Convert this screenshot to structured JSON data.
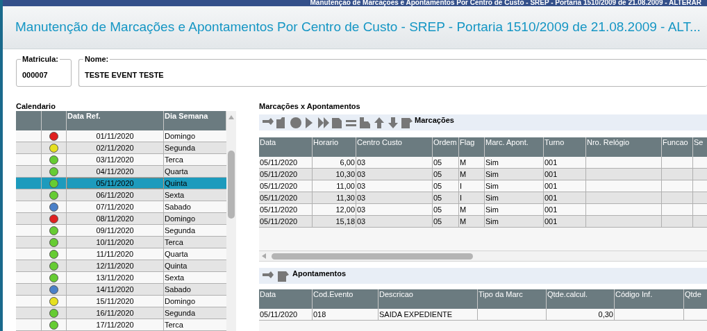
{
  "window": {
    "title": "Manutenção de Marcações e Apontamentos Por Centro de Custo - SREP - Portaria 1510/2009 de 21.08.2009 - ALTERAR"
  },
  "header": {
    "title": "Manutenção de Marcações e Apontamentos Por Centro de Custo - SREP - Portaria 1510/2009 de 21.08.2009 - ALT..."
  },
  "fields": [
    {
      "label": "Matricula:",
      "value": "000007"
    },
    {
      "label": "Nome:",
      "value": "TESTE EVENT TESTE"
    }
  ],
  "calendar": {
    "title": "Calendario",
    "columns": [
      "Data Ref.",
      "Dia Semana"
    ],
    "rows": [
      {
        "date": "01/11/2020",
        "day": "Domingo",
        "color": "#e02020",
        "selected": false
      },
      {
        "date": "02/11/2020",
        "day": "Segunda",
        "color": "#e6e020",
        "selected": false
      },
      {
        "date": "03/11/2020",
        "day": "Terca",
        "color": "#66cc33",
        "selected": false
      },
      {
        "date": "04/11/2020",
        "day": "Quarta",
        "color": "#66cc33",
        "selected": false
      },
      {
        "date": "05/11/2020",
        "day": "Quinta",
        "color": "#66cc33",
        "selected": true
      },
      {
        "date": "06/11/2020",
        "day": "Sexta",
        "color": "#66cc33",
        "selected": false
      },
      {
        "date": "07/11/2020",
        "day": "Sabado",
        "color": "#4a80c8",
        "selected": false
      },
      {
        "date": "08/11/2020",
        "day": "Domingo",
        "color": "#e02020",
        "selected": false
      },
      {
        "date": "09/11/2020",
        "day": "Segunda",
        "color": "#66cc33",
        "selected": false
      },
      {
        "date": "10/11/2020",
        "day": "Terca",
        "color": "#66cc33",
        "selected": false
      },
      {
        "date": "11/11/2020",
        "day": "Quarta",
        "color": "#66cc33",
        "selected": false
      },
      {
        "date": "12/11/2020",
        "day": "Quinta",
        "color": "#66cc33",
        "selected": false
      },
      {
        "date": "13/11/2020",
        "day": "Sexta",
        "color": "#66cc33",
        "selected": false
      },
      {
        "date": "14/11/2020",
        "day": "Sabado",
        "color": "#4a80c8",
        "selected": false
      },
      {
        "date": "15/11/2020",
        "day": "Domingo",
        "color": "#e6e020",
        "selected": false
      },
      {
        "date": "16/11/2020",
        "day": "Segunda",
        "color": "#66cc33",
        "selected": false
      },
      {
        "date": "17/11/2020",
        "day": "Terca",
        "color": "#66cc33",
        "selected": false
      }
    ]
  },
  "panel": {
    "title": "Marcações x Apontamentos"
  },
  "marcacoes": {
    "title": "Marcações",
    "columns": [
      "Data",
      "Horario",
      "Centro Custo",
      "Ordem",
      "Flag",
      "Marc. Apont.",
      "Turno",
      "Nro. Relógio",
      "Funcao",
      "Se"
    ],
    "rows": [
      [
        "05/11/2020",
        "6,00",
        "03",
        "05",
        "M",
        "Sim",
        "001",
        "",
        "",
        ""
      ],
      [
        "05/11/2020",
        "10,30",
        "03",
        "05",
        "M",
        "Sim",
        "001",
        "",
        "",
        ""
      ],
      [
        "05/11/2020",
        "11,00",
        "03",
        "05",
        "I",
        "Sim",
        "001",
        "",
        "",
        ""
      ],
      [
        "05/11/2020",
        "11,30",
        "03",
        "05",
        "I",
        "Sim",
        "001",
        "",
        "",
        ""
      ],
      [
        "05/11/2020",
        "12,00",
        "03",
        "05",
        "M",
        "Sim",
        "001",
        "",
        "",
        ""
      ],
      [
        "05/11/2020",
        "15,18",
        "03",
        "05",
        "M",
        "Sim",
        "001",
        "",
        "",
        ""
      ]
    ]
  },
  "apontamentos": {
    "title": "Apontamentos",
    "columns": [
      "Data",
      "Cod.Evento",
      "Descricao",
      "Tipo da Marc",
      "Qtde.calcul.",
      "Código Inf.",
      "Qtde"
    ],
    "rows": [
      [
        "05/11/2020",
        "018",
        "SAIDA EXPEDIENTE",
        "",
        "0,30",
        "",
        ""
      ]
    ]
  }
}
